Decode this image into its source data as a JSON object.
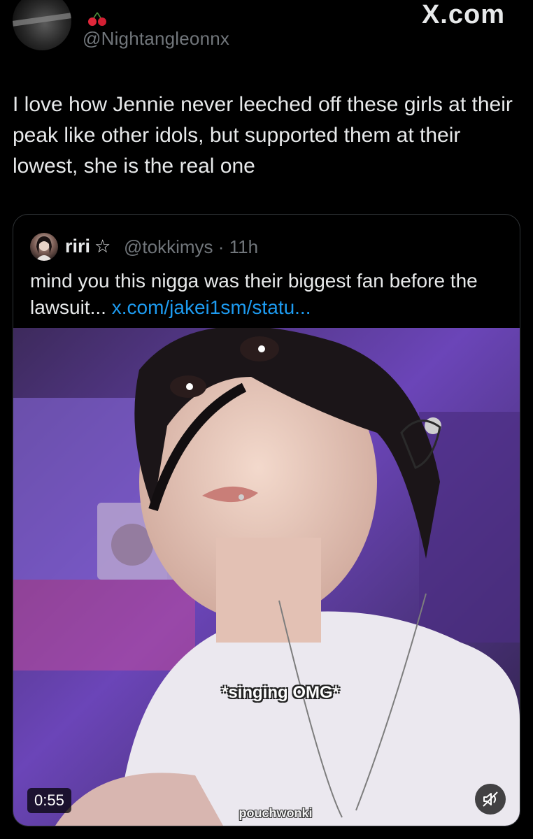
{
  "header": {
    "handle": "@Nightangleonnx",
    "site_label": "X.com",
    "avatar_icon": "profile-avatar",
    "emoji_icon": "cherries-icon"
  },
  "tweet": {
    "text": "I love how Jennie never leeched off these girls at their peak like other idols, but supported them at their lowest, she is the real one"
  },
  "quote": {
    "name": "riri",
    "badge_icon": "star-outline-icon",
    "handle": "@tokkimys",
    "separator": "·",
    "time": "11h",
    "text": "mind you this nigga was their biggest fan before the lawsuit...",
    "link": "x.com/jakei1sm/statu..."
  },
  "video": {
    "duration": "0:55",
    "caption": "*singing OMG*",
    "watermark": "pouchwonki",
    "mute_icon": "speaker-muted-icon",
    "background_color": "#5b3a8c",
    "shirt_color": "#ebe8ef"
  },
  "colors": {
    "background": "#000000",
    "text": "#e7e9ea",
    "secondary": "#71767b",
    "link": "#1d9bf0",
    "border": "#2f3336"
  }
}
